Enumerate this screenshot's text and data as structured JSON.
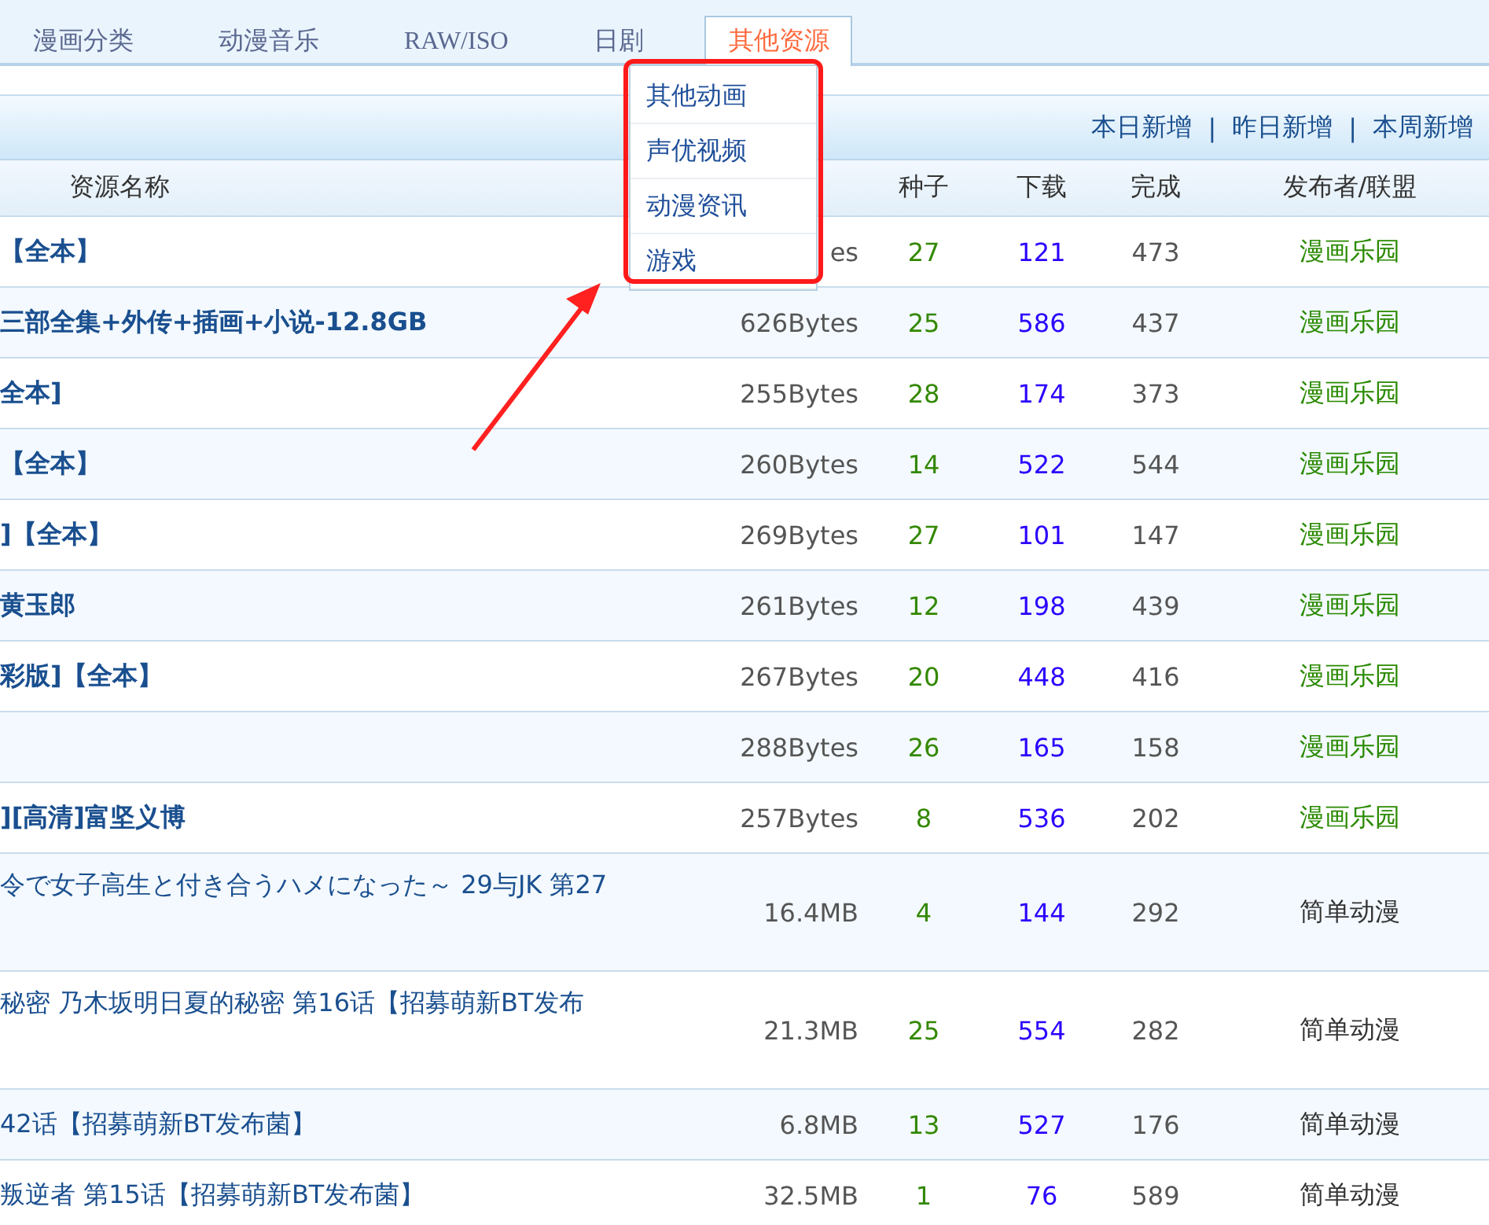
{
  "tabs": [
    {
      "label": "漫画分类",
      "selected": false
    },
    {
      "label": "动漫音乐",
      "selected": false
    },
    {
      "label": "RAW/ISO",
      "selected": false
    },
    {
      "label": "日剧",
      "selected": false
    },
    {
      "label": "其他资源",
      "selected": true
    }
  ],
  "dropdown": {
    "items": [
      "其他动画",
      "声优视频",
      "动漫资讯",
      "游戏"
    ]
  },
  "quick_links": [
    "本日新增",
    "昨日新增",
    "本周新增"
  ],
  "quick_links_separator": "|",
  "table": {
    "columns": [
      "资源名称",
      "种子",
      "下载",
      "完成",
      "发布者/联盟"
    ],
    "rows": [
      {
        "name": "【全本】",
        "kind": "bold",
        "size": "es",
        "seeds": "27",
        "downloads": "121",
        "completed": "473",
        "publisher": "漫画乐园",
        "color": "#2a8a00"
      },
      {
        "name": "三部全集+外传+插画+小说-12.8GB",
        "kind": "bold",
        "size": "626Bytes",
        "seeds": "25",
        "downloads": "586",
        "completed": "437",
        "publisher": "漫画乐园",
        "color": "#2a8a00"
      },
      {
        "name": "全本]",
        "kind": "bold",
        "size": "255Bytes",
        "seeds": "28",
        "downloads": "174",
        "completed": "373",
        "publisher": "漫画乐园",
        "color": "#2a8a00"
      },
      {
        "name": "【全本】",
        "kind": "bold",
        "size": "260Bytes",
        "seeds": "14",
        "downloads": "522",
        "completed": "544",
        "publisher": "漫画乐园",
        "color": "#2a8a00"
      },
      {
        "name": "]【全本】",
        "kind": "bold",
        "size": "269Bytes",
        "seeds": "27",
        "downloads": "101",
        "completed": "147",
        "publisher": "漫画乐园",
        "color": "#2a8a00"
      },
      {
        "name": "黄玉郎",
        "kind": "bold",
        "size": "261Bytes",
        "seeds": "12",
        "downloads": "198",
        "completed": "439",
        "publisher": "漫画乐园",
        "color": "#2a8a00"
      },
      {
        "name": "彩版]【全本】",
        "kind": "bold",
        "size": "267Bytes",
        "seeds": "20",
        "downloads": "448",
        "completed": "416",
        "publisher": "漫画乐园",
        "color": "#2a8a00"
      },
      {
        "kind": "bold",
        "size": "288Bytes",
        "seeds": "26",
        "downloads": "165",
        "completed": "158",
        "publisher": "漫画乐园",
        "color": "#2a8a00"
      },
      {
        "name": "][高清]富坚义博",
        "kind": "bold",
        "size": "257Bytes",
        "seeds": "8",
        "downloads": "536",
        "completed": "202",
        "publisher": "漫画乐园",
        "color": "#2a8a00"
      },
      {
        "name": "令で女子高生と付き合うハメになった～ 29与JK 第27",
        "kind": "wrapped",
        "size": "16.4MB",
        "seeds": "4",
        "downloads": "144",
        "completed": "292",
        "publisher": "简单动漫",
        "color": "#333333"
      },
      {
        "name": "秘密 乃木坂明日夏的秘密 第16话【招募萌新BT发布",
        "kind": "wrapped",
        "size": "21.3MB",
        "seeds": "25",
        "downloads": "554",
        "completed": "282",
        "publisher": "简单动漫",
        "color": "#333333"
      },
      {
        "name": "42话【招募萌新BT发布菌】",
        "kind": "plain",
        "size": "6.8MB",
        "seeds": "13",
        "downloads": "527",
        "completed": "176",
        "publisher": "简单动漫",
        "color": "#333333"
      },
      {
        "name": "叛逆者 第15话【招募萌新BT发布菌】",
        "kind": "plain",
        "size": "32.5MB",
        "seeds": "1",
        "downloads": "76",
        "completed": "589",
        "publisher": "简单动漫",
        "color": "#333333"
      }
    ]
  }
}
